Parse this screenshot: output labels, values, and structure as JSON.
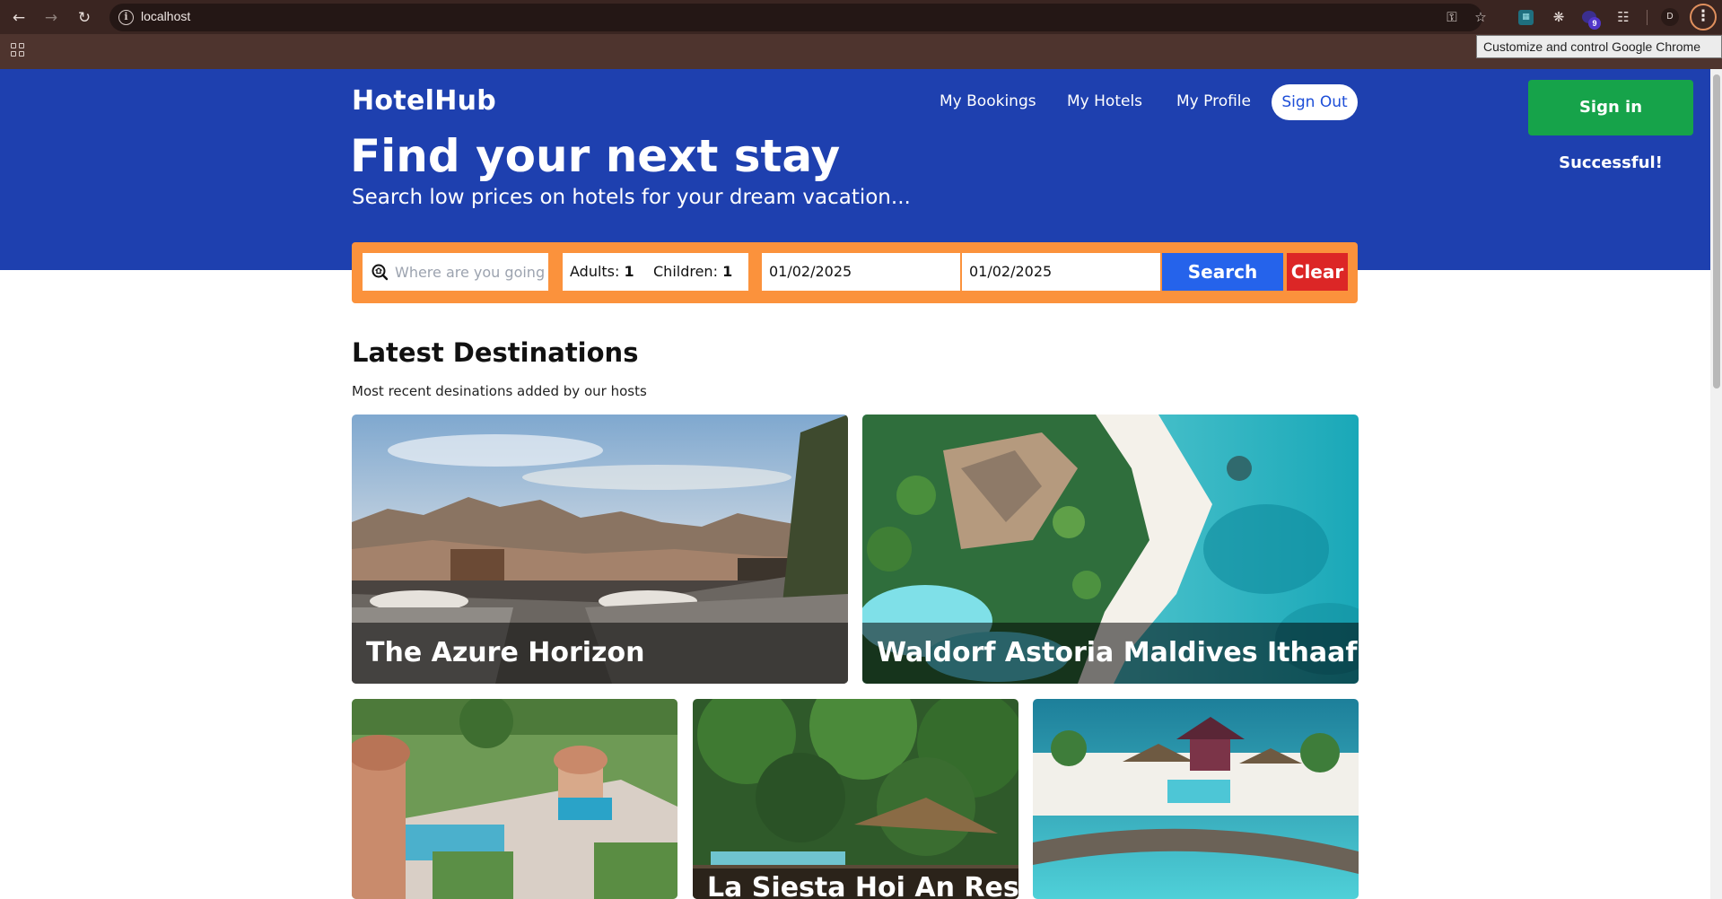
{
  "browser": {
    "url": "localhost",
    "tooltip": "Customize and control Google Chrome",
    "profile_initial": "D",
    "extension_badge_count": "9"
  },
  "app": {
    "brand": "HotelHub",
    "nav": {
      "bookings": "My Bookings",
      "hotels": "My Hotels",
      "profile": "My Profile",
      "signout": "Sign Out"
    },
    "toast": "Sign in Successful!",
    "hero": {
      "title": "Find your next stay",
      "subtitle": "Search low prices on hotels for your dream vacation..."
    },
    "search": {
      "destination_placeholder": "Where are you going?",
      "adults_label": "Adults:",
      "adults_value": "1",
      "children_label": "Children:",
      "children_value": "1",
      "check_in": "01/02/2025",
      "check_out": "01/02/2025",
      "search_label": "Search",
      "clear_label": "Clear"
    },
    "latest": {
      "title": "Latest Destinations",
      "subtitle": "Most recent desinations added by our hosts",
      "cards": [
        {
          "name": "The Azure Horizon"
        },
        {
          "name": "Waldorf Astoria Maldives Ithaafushi"
        },
        {
          "name": ""
        },
        {
          "name": "La Siesta Hoi An Resort"
        },
        {
          "name": ""
        }
      ]
    }
  },
  "colors": {
    "hero": "#1e40af",
    "search_bar": "#fb923c",
    "search_button": "#2563eb",
    "clear_button": "#dc2626",
    "toast": "#16a34a"
  }
}
